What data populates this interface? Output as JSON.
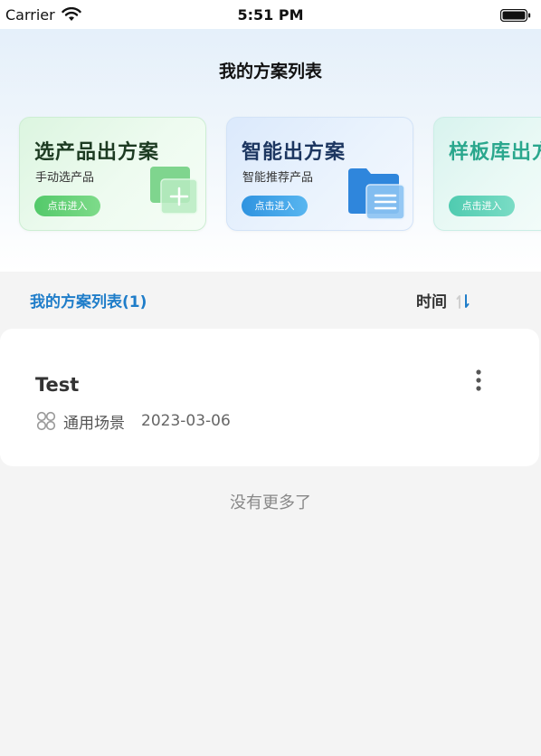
{
  "status_bar": {
    "carrier": "Carrier",
    "time": "5:51 PM"
  },
  "nav": {
    "title": "我的方案列表"
  },
  "cards": [
    {
      "title": "选产品出方案",
      "subtitle": "手动选产品",
      "button": "点击进入",
      "icon": "add-document-icon"
    },
    {
      "title": "智能出方案",
      "subtitle": "智能推荐产品",
      "button": "点击进入",
      "icon": "folder-icon"
    },
    {
      "title": "样板库出方案",
      "subtitle": "",
      "button": "点击进入",
      "icon": ""
    }
  ],
  "list_header": {
    "title": "我的方案列表(1)",
    "sort_label": "时间",
    "sort_icon": "sort-icon"
  },
  "plans": [
    {
      "name": "Test",
      "scene": "通用场景",
      "date": "2023-03-06",
      "icon": "grid-icon",
      "menu_icon": "more-vertical-icon"
    }
  ],
  "footer": {
    "no_more": "没有更多了"
  },
  "colors": {
    "accent": "#1f7dc9",
    "green": "#53c96a",
    "blue": "#2f93e0",
    "teal": "#4fcbb0"
  }
}
